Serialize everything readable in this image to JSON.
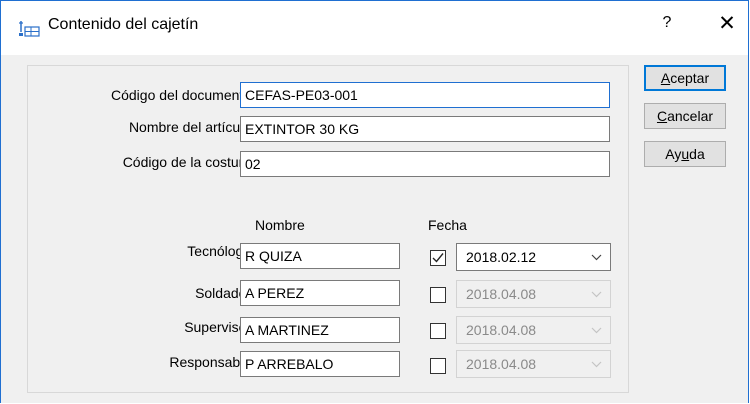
{
  "window": {
    "title": "Contenido del cajetín",
    "help_label": "?",
    "close_label": "✕"
  },
  "fields": [
    {
      "label": "Código del documento:",
      "value": "CEFAS-PE03-001"
    },
    {
      "label": "Nombre del artículo:",
      "value": "EXTINTOR 30 KG"
    },
    {
      "label": "Código de la costura:",
      "value": "02"
    }
  ],
  "columns": {
    "nombre": "Nombre",
    "fecha": "Fecha"
  },
  "people": [
    {
      "role": "Tecnólogo:",
      "name": "R QUIZA",
      "checked": true,
      "date": "2018.02.12",
      "enabled": true
    },
    {
      "role": "Soldador:",
      "name": "A PEREZ",
      "checked": false,
      "date": "2018.04.08",
      "enabled": false
    },
    {
      "role": "Supervisor:",
      "name": "A MARTINEZ",
      "checked": false,
      "date": "2018.04.08",
      "enabled": false
    },
    {
      "role": "Responsable:",
      "name": "P ARREBALO",
      "checked": false,
      "date": "2018.04.08",
      "enabled": false
    }
  ],
  "buttons": {
    "accept": {
      "first": "A",
      "rest": "ceptar"
    },
    "cancel": {
      "first": "C",
      "rest": "ancelar"
    },
    "help": {
      "pre": "Ay",
      "ul": "u",
      "post": "da"
    }
  },
  "colors": {
    "accent": "#1f6fd1",
    "dialog_bg": "#f0f0f0"
  },
  "icons": {
    "title": "titleblock-icon",
    "dropdown": "chevron-down-icon",
    "check": "checkmark-icon"
  }
}
